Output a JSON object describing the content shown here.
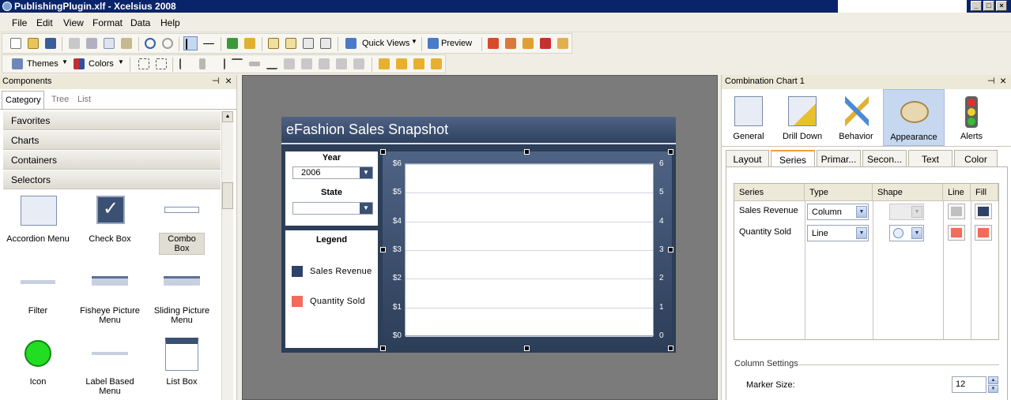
{
  "window": {
    "title": "PublishingPlugin.xlf - Xcelsius 2008",
    "min_glyph": "_",
    "max_glyph": "□",
    "close_glyph": "×"
  },
  "menu": [
    "File",
    "Edit",
    "View",
    "Format",
    "Data",
    "Help"
  ],
  "toolbar": {
    "quick_views": "Quick Views",
    "preview": "Preview",
    "themes": "Themes",
    "colors": "Colors"
  },
  "components_panel": {
    "title": "Components",
    "pin": "⊣",
    "close": "×",
    "tabs": [
      "Category",
      "Tree",
      "List"
    ],
    "categories": [
      "Favorites",
      "Charts",
      "Containers",
      "Selectors"
    ],
    "items": [
      "Accordion Menu",
      "Check Box",
      "Combo Box",
      "Filter",
      "Fisheye Picture Menu",
      "Sliding Picture Menu",
      "Icon",
      "Label Based Menu",
      "List Box"
    ]
  },
  "dashboard": {
    "title": "eFashion Sales Snapshot",
    "year_label": "Year",
    "year_value": "2006",
    "state_label": "State",
    "state_value": "",
    "legend_title": "Legend",
    "legend": [
      {
        "name": "Sales Revenue",
        "color": "#2e4268"
      },
      {
        "name": "Quantity Sold",
        "color": "#f26b5b"
      }
    ],
    "chart": {
      "left_ticks": [
        "$6",
        "$5",
        "$4",
        "$3",
        "$2",
        "$1",
        "$0"
      ],
      "right_ticks": [
        "6",
        "5",
        "4",
        "3",
        "2",
        "1",
        "0"
      ]
    }
  },
  "properties_panel": {
    "title": "Combination Chart 1",
    "pin": "⊣",
    "close": "×",
    "categories": [
      "General",
      "Drill Down",
      "Behavior",
      "Appearance",
      "Alerts"
    ],
    "active_category": "Appearance",
    "tabs": [
      "Layout",
      "Series",
      "Primar...",
      "Secon...",
      "Text",
      "Color"
    ],
    "active_tab": "Series",
    "grid_headers": [
      "Series",
      "Type",
      "Shape",
      "Line",
      "Fill"
    ],
    "series": [
      {
        "name": "Sales Revenue",
        "type": "Column",
        "line_color": "#c0c0c0",
        "fill_color": "#2e4268"
      },
      {
        "name": "Quantity Sold",
        "type": "Line",
        "line_color": "#f26b5b",
        "fill_color": "#f26b5b"
      }
    ],
    "column_settings_label": "Column Settings",
    "marker_size_label": "Marker Size:",
    "marker_size_value": "12"
  }
}
